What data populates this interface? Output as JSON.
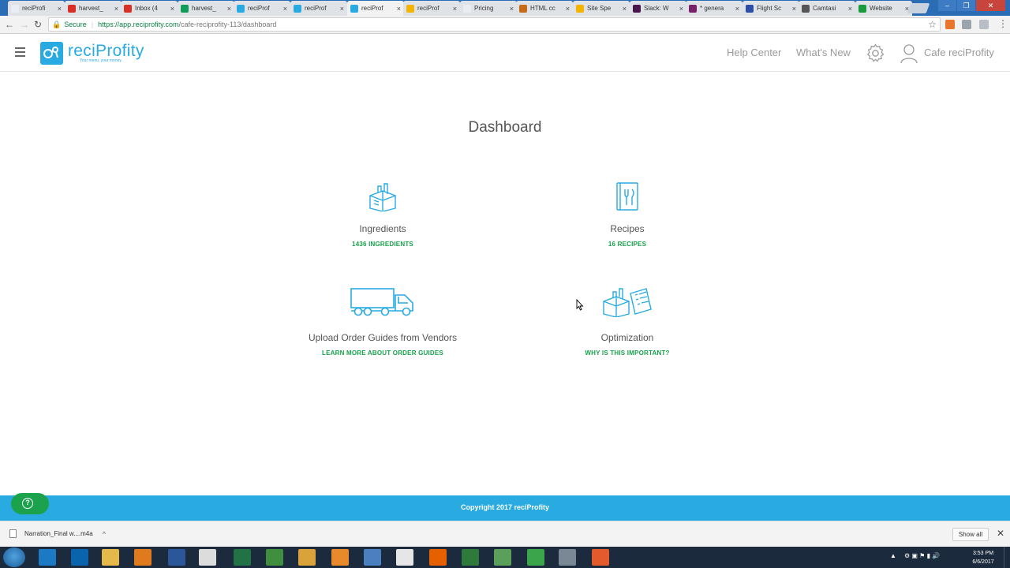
{
  "browser": {
    "tabs": [
      {
        "label": "reciProfi",
        "fav": "#e9eef5"
      },
      {
        "label": "harvest_",
        "fav": "#d93025"
      },
      {
        "label": "Inbox (4",
        "fav": "#d93025"
      },
      {
        "label": "harvest_",
        "fav": "#0f9d58"
      },
      {
        "label": "reciProf",
        "fav": "#29abe2"
      },
      {
        "label": "reciProf",
        "fav": "#29abe2"
      },
      {
        "label": "reciProf",
        "fav": "#29abe2",
        "active": true
      },
      {
        "label": "reciProf",
        "fav": "#f4b400"
      },
      {
        "label": "Pricing",
        "fav": "#e9eef5"
      },
      {
        "label": "HTML cc",
        "fav": "#c76b1a"
      },
      {
        "label": "Site Spe",
        "fav": "#f4b400"
      },
      {
        "label": "Slack: W",
        "fav": "#4a154b"
      },
      {
        "label": "* genera",
        "fav": "#7a1f6a"
      },
      {
        "label": "Flight Sc",
        "fav": "#2b4fa8"
      },
      {
        "label": "Camtasi",
        "fav": "#555555"
      },
      {
        "label": "Website",
        "fav": "#1a9c3e"
      }
    ],
    "tab_close": "×",
    "back_icon": "←",
    "forward_icon": "→",
    "reload_icon": "↻",
    "secure_label": "Secure",
    "url_host": "https://app.reciprofity.com",
    "url_path": "/cafe-reciprofity-113/dashboard",
    "star_icon": "☆",
    "window_controls": [
      "–",
      "❐",
      "✕"
    ]
  },
  "header": {
    "logo_name": "reciProfity",
    "logo_tagline": "Your menu, your money",
    "help_center": "Help Center",
    "whats_new": "What's New",
    "account_name": "Cafe reciProfity"
  },
  "main": {
    "title": "Dashboard",
    "cards": [
      {
        "label": "Ingredients",
        "link": "1436 INGREDIENTS",
        "icon": "ingredients-box-icon"
      },
      {
        "label": "Recipes",
        "link": "16 RECIPES",
        "icon": "recipe-book-icon"
      },
      {
        "label": "Upload Order Guides from Vendors",
        "link": "LEARN MORE ABOUT ORDER GUIDES",
        "icon": "truck-icon"
      },
      {
        "label": "Optimization",
        "link": "WHY IS THIS IMPORTANT?",
        "icon": "optimization-icon"
      }
    ]
  },
  "footer": {
    "copyright": "Copyright 2017 reciProfity",
    "help_icon": "?"
  },
  "downloads": {
    "file_name": "Narration_Final w....m4a",
    "chevron": "^",
    "show_all": "Show all",
    "close": "✕"
  },
  "taskbar": {
    "time": "3:53 PM",
    "date": "6/6/2017",
    "tray_arrow": "▲",
    "apps": [
      {
        "name": "internet-explorer",
        "color": "#1c79c4"
      },
      {
        "name": "outlook",
        "color": "#0a64ad"
      },
      {
        "name": "file-explorer",
        "color": "#e5b84a"
      },
      {
        "name": "media-player",
        "color": "#e07a1f"
      },
      {
        "name": "word",
        "color": "#2b579a"
      },
      {
        "name": "chrome",
        "color": "#dcdcdc"
      },
      {
        "name": "excel",
        "color": "#217346"
      },
      {
        "name": "app-green",
        "color": "#3f8f3f"
      },
      {
        "name": "app-yellow",
        "color": "#d9a23b"
      },
      {
        "name": "app-orange",
        "color": "#e8892b"
      },
      {
        "name": "app-blue",
        "color": "#4a7fc0"
      },
      {
        "name": "app-ledger",
        "color": "#e6e6e6"
      },
      {
        "name": "firefox",
        "color": "#e66000"
      },
      {
        "name": "app-circle",
        "color": "#2d7a3a"
      },
      {
        "name": "app-s",
        "color": "#5aa05a"
      },
      {
        "name": "camtasia-green",
        "color": "#3aa54a"
      },
      {
        "name": "app-gray",
        "color": "#7a8896"
      },
      {
        "name": "camtasia-orange",
        "color": "#e35a2c"
      }
    ]
  },
  "colors": {
    "brand": "#29abe2",
    "link_green": "#17a34a",
    "help_green": "#1ca24c"
  }
}
